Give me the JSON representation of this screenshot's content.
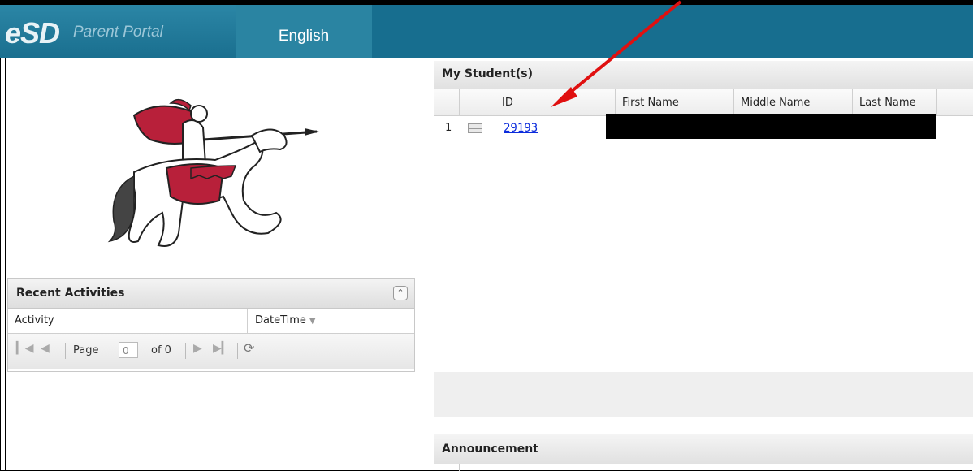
{
  "header": {
    "logo_esd": "eSD",
    "logo_portal": "Parent Portal",
    "language_button": "English"
  },
  "recent_activities": {
    "title": "Recent Activities",
    "columns": [
      "Activity",
      "DateTime"
    ],
    "pager": {
      "page_label": "Page",
      "page_value": "0",
      "of_label": "of 0"
    }
  },
  "students": {
    "title": "My Student(s)",
    "columns": [
      "ID",
      "First Name",
      "Middle Name",
      "Last Name"
    ],
    "rows": [
      {
        "num": "1",
        "id": "29193"
      }
    ]
  },
  "announcement": {
    "title": "Announcement"
  },
  "colors": {
    "header_bg": "#176e8f",
    "link": "#0b2bdc",
    "arrow": "#e01010"
  }
}
